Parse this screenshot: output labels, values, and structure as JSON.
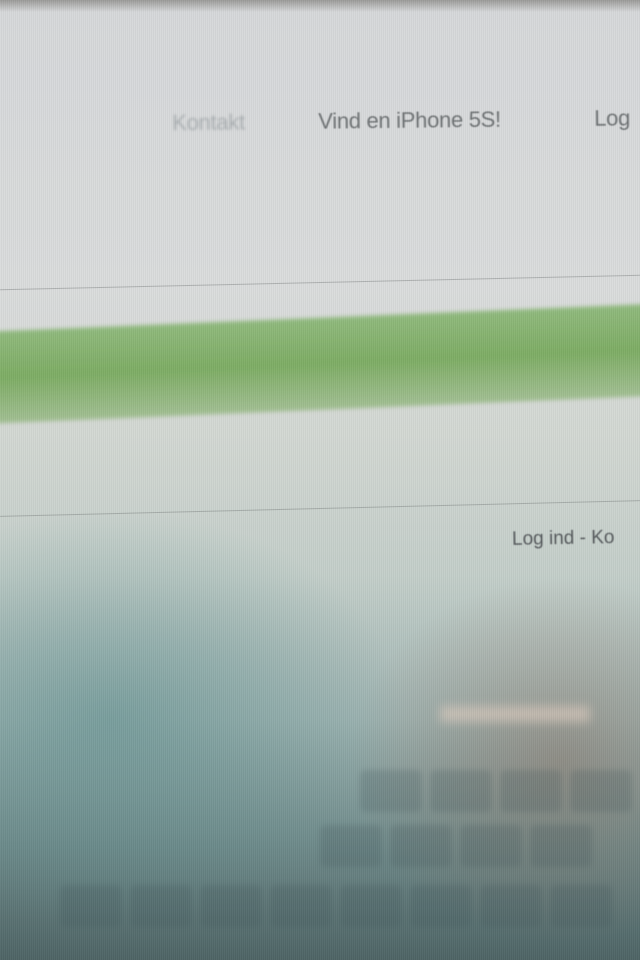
{
  "nav": {
    "items": [
      {
        "label": "Kontakt"
      },
      {
        "label": "Vind en iPhone 5S!"
      },
      {
        "label": "Log"
      }
    ]
  },
  "account": {
    "login_link": "Log ind - Ko"
  }
}
